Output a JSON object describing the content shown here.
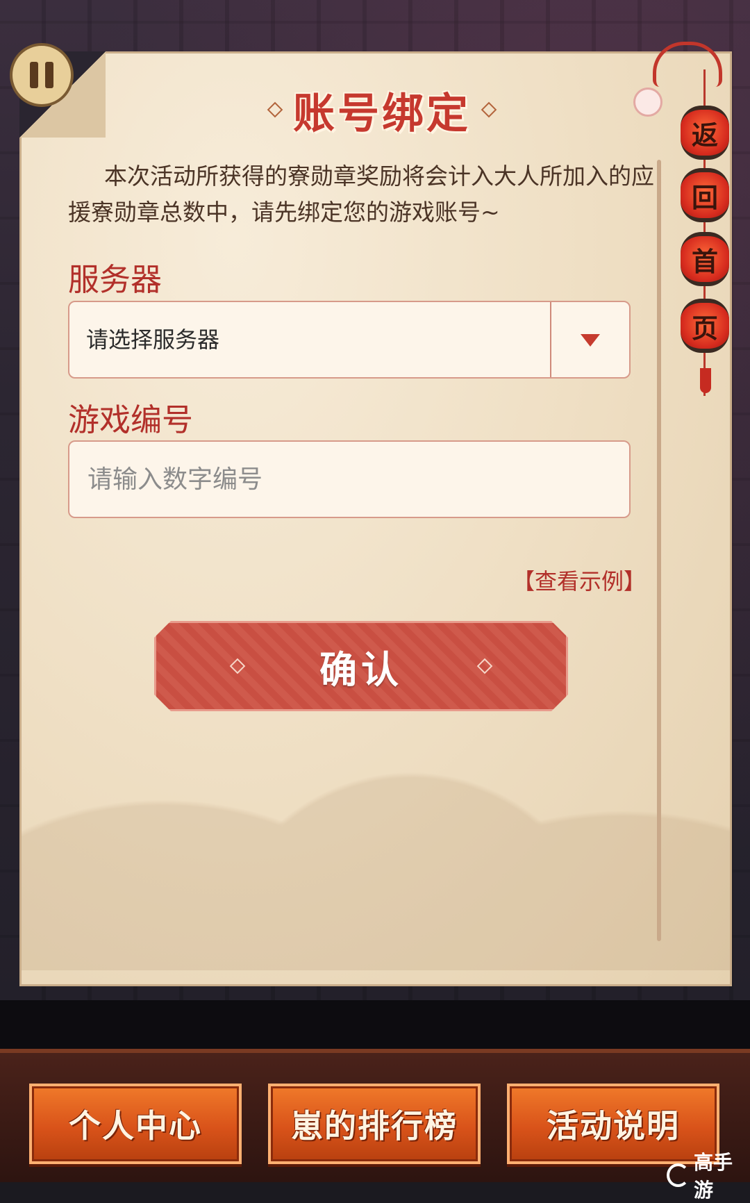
{
  "dialog": {
    "title": "账号绑定",
    "description": "本次活动所获得的寮勋章奖励将会计入大人所加入的应援寮勋章总数中，请先绑定您的游戏账号~",
    "server_label": "服务器",
    "server_select_value": "请选择服务器",
    "game_id_label": "游戏编号",
    "game_id_placeholder": "请输入数字编号",
    "example_link": "【查看示例】",
    "confirm_label": "确认"
  },
  "lanterns": [
    "返",
    "回",
    "首",
    "页"
  ],
  "bottom_nav": {
    "personal_center": "个人中心",
    "ranking": "崽的排行榜",
    "event_info": "活动说明"
  },
  "watermark": {
    "text": "高手游"
  },
  "icons": [
    "pause-icon",
    "chevron-down-icon",
    "flower-icon",
    "lantern-icon",
    "logo-icon"
  ],
  "colors": {
    "accent_red": "#c6392e",
    "label_red": "#b2302a",
    "nav_orange": "#e0601f",
    "paper": "#efdfc4"
  }
}
